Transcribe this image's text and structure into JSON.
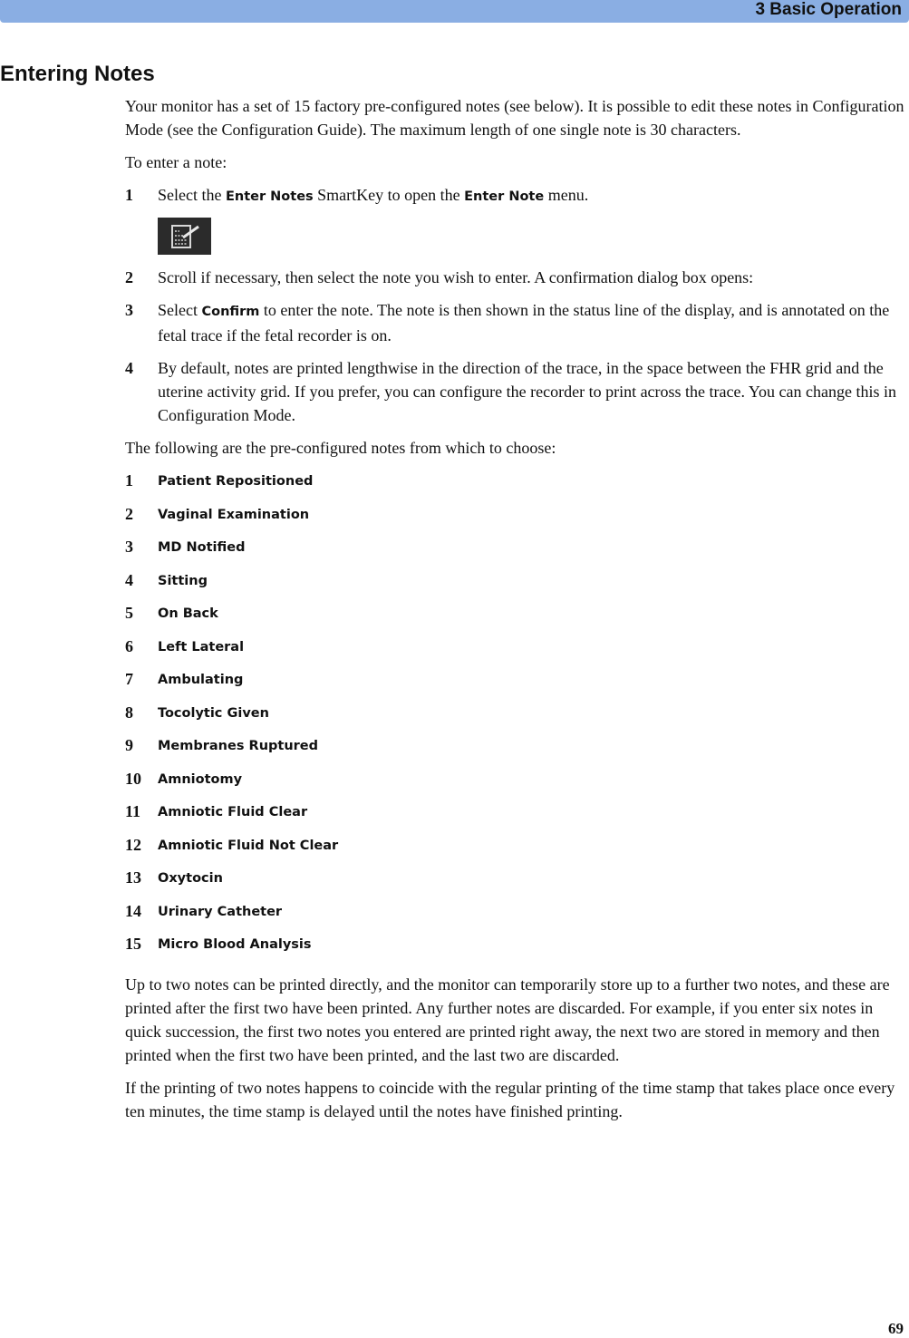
{
  "header": {
    "chapter_title": "3  Basic Operation"
  },
  "section": {
    "title": "Entering Notes"
  },
  "intro": "Your monitor has a set of 15 factory pre-configured notes (see below). It is possible to edit these notes in Configuration Mode (see the Configuration Guide). The maximum length of one single note is 30 characters.",
  "procedure_intro": "To enter a note:",
  "steps": [
    {
      "num": "1",
      "before": "Select the ",
      "term1": "Enter Notes",
      "middle": " SmartKey to open the ",
      "term2": "Enter Note",
      "after": " menu.",
      "icon": "enter-notes-smartkey-icon"
    },
    {
      "num": "2",
      "text": "Scroll if necessary, then select the note you wish to enter. A confirmation dialog box opens:"
    },
    {
      "num": "3",
      "before": "Select ",
      "term": "Confirm",
      "after": " to enter the note. The note is then shown in the status line of the display, and is annotated on the fetal trace if the fetal recorder is on."
    },
    {
      "num": "4",
      "text": "By default, notes are printed lengthwise in the direction of the trace, in the space between the FHR grid and the uterine activity grid. If you prefer, you can configure the recorder to print across the trace. You can change this in Configuration Mode."
    }
  ],
  "notes_intro": "The following are the pre-configured notes from which to choose:",
  "notes": [
    {
      "num": "1",
      "label": "Patient Repositioned"
    },
    {
      "num": "2",
      "label": "Vaginal Examination"
    },
    {
      "num": "3",
      "label": "MD Notified"
    },
    {
      "num": "4",
      "label": "Sitting"
    },
    {
      "num": "5",
      "label": "On Back"
    },
    {
      "num": "6",
      "label": "Left Lateral"
    },
    {
      "num": "7",
      "label": "Ambulating"
    },
    {
      "num": "8",
      "label": "Tocolytic Given"
    },
    {
      "num": "9",
      "label": "Membranes Ruptured"
    },
    {
      "num": "10",
      "label": "Amniotomy"
    },
    {
      "num": "11",
      "label": "Amniotic Fluid Clear"
    },
    {
      "num": "12",
      "label": "Amniotic Fluid Not Clear"
    },
    {
      "num": "13",
      "label": "Oxytocin"
    },
    {
      "num": "14",
      "label": "Urinary Catheter"
    },
    {
      "num": "15",
      "label": "Micro Blood Analysis"
    }
  ],
  "closing_paragraphs": [
    "Up to two notes can be printed directly, and the monitor can temporarily store up to a further two notes, and these are printed after the first two have been printed. Any further notes are discarded. For example, if you enter six notes in quick succession, the first two notes you entered are printed right away, the next two are stored in memory and then printed when the first two have been printed, and the last two are discarded.",
    "If the printing of two notes happens to coincide with the regular printing of the time stamp that takes place once every ten minutes, the time stamp is delayed until the notes have finished printing."
  ],
  "footer": {
    "page_number": "69"
  }
}
